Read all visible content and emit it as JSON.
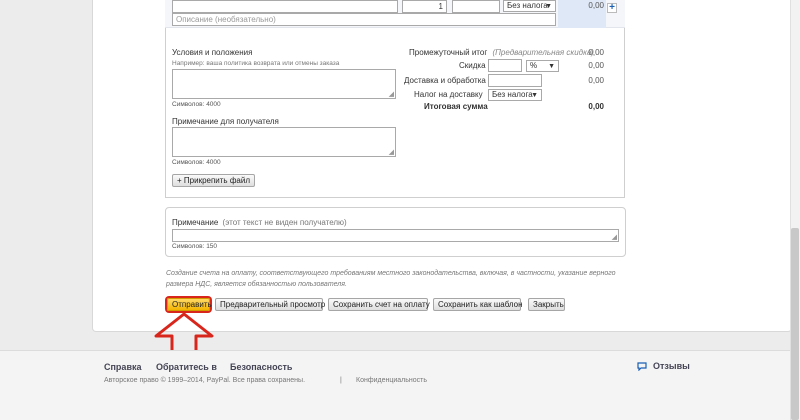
{
  "item_row": {
    "description_placeholder": "Описание (необязательно)",
    "quantity": "1",
    "tax_select": "Без налога",
    "amount": "0,00",
    "add_icon": "plus-icon"
  },
  "terms": {
    "label": "Условия и положения",
    "hint": "Например: ваша политика возврата или отмены заказа",
    "counter": "Символов: 4000"
  },
  "note_recipient": {
    "label": "Примечание для получателя",
    "counter": "Символов: 4000"
  },
  "attach_button": "+ Прикрепить файл",
  "totals": {
    "subtotal_label": "Промежуточный итог",
    "subtotal_hint": "(Предварительная скидка)",
    "subtotal_value": "0,00",
    "discount_label": "Скидка",
    "discount_select": "%",
    "discount_value": "0,00",
    "shipping_label": "Доставка и обработка",
    "shipping_value": "0,00",
    "shipping_tax_label": "Налог на доставку",
    "shipping_tax_select": "Без налога",
    "total_label": "Итоговая сумма",
    "total_value": "0,00"
  },
  "private_note": {
    "label": "Примечание",
    "label_hint": "(этот текст не виден получателю)",
    "counter": "Символов: 150"
  },
  "disclaimer": "Создание счета на оплату, соответствующего требованиям местного законодательства, включая, в частности, указание верного размера НДС, является обязанностью пользователя.",
  "buttons": {
    "send": "Отправить",
    "preview": "Предварительный просмотр",
    "save": "Сохранить счет на оплату",
    "save_template": "Сохранить как шаблон",
    "close": "Закрыть"
  },
  "footer": {
    "help": "Справка",
    "contact": "Обратитесь в",
    "security": "Безопасность",
    "feedback": "Отзывы",
    "copyright": "Авторское право © 1999–2014, PayPal. Все права сохранены.",
    "separator": "|",
    "privacy": "Конфиденциальность"
  },
  "colors": {
    "primary_button": "#f4b400",
    "highlight_outline": "#d9261c",
    "link_blue": "#1a5fb4"
  }
}
